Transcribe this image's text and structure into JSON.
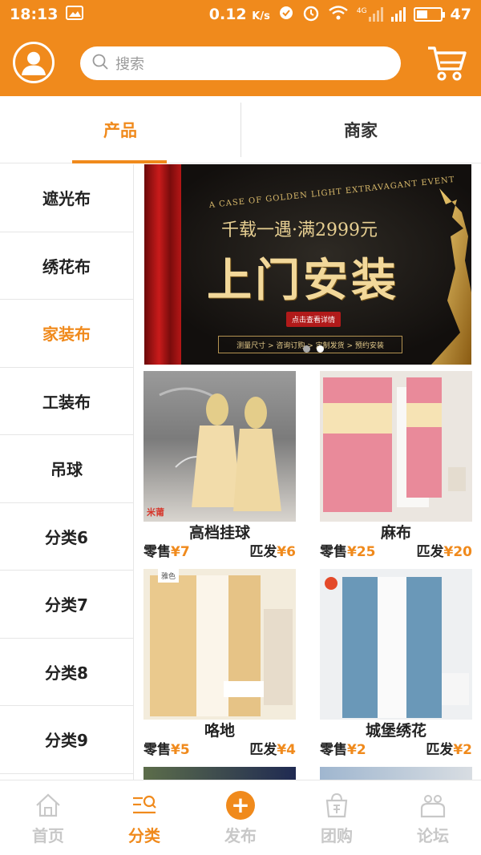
{
  "status_bar": {
    "time": "18:13",
    "speed": "0.12",
    "speed_unit": "K/s",
    "network": "4G",
    "battery": "47",
    "battery_level": 0.47
  },
  "header": {
    "search_placeholder": "搜索",
    "avatar_icon": "user-icon",
    "cart_icon": "cart-icon"
  },
  "tabs": [
    {
      "label": "产品",
      "active": true
    },
    {
      "label": "商家",
      "active": false
    }
  ],
  "sidebar": {
    "items": [
      {
        "label": "遮光布",
        "active": false
      },
      {
        "label": "绣花布",
        "active": false
      },
      {
        "label": "家装布",
        "active": true
      },
      {
        "label": "工装布",
        "active": false
      },
      {
        "label": "吊球",
        "active": false
      },
      {
        "label": "分类6",
        "active": false
      },
      {
        "label": "分类7",
        "active": false
      },
      {
        "label": "分类8",
        "active": false
      },
      {
        "label": "分类9",
        "active": false
      }
    ]
  },
  "banner": {
    "eng_text": "A CASE OF GOLDEN LIGHT EXTRAVAGANT EVENT",
    "subtitle": "千载一遇·满2999元",
    "headline": "上门安装",
    "button": "点击查看详情",
    "steps": "测量尺寸 > 咨询订购 > 定制发货 > 预约安装"
  },
  "products": [
    {
      "name": "高档挂球",
      "retail_label": "零售",
      "retail_price": "¥7",
      "wholesale_label": "匹发",
      "wholesale_price": "¥6",
      "watermark": "米莆"
    },
    {
      "name": "麻布",
      "retail_label": "零售",
      "retail_price": "¥25",
      "wholesale_label": "匹发",
      "wholesale_price": "¥20"
    },
    {
      "name": "咯地",
      "retail_label": "零售",
      "retail_price": "¥5",
      "wholesale_label": "匹发",
      "wholesale_price": "¥4",
      "tag": "雅色"
    },
    {
      "name": "城堡绣花",
      "retail_label": "零售",
      "retail_price": "¥2",
      "wholesale_label": "匹发",
      "wholesale_price": "¥2"
    }
  ],
  "bottom_nav": [
    {
      "label": "首页",
      "icon": "home-icon",
      "active": false
    },
    {
      "label": "分类",
      "icon": "category-search-icon",
      "active": true
    },
    {
      "label": "发布",
      "icon": "plus-icon",
      "active": false
    },
    {
      "label": "团购",
      "icon": "group-buy-bag-icon",
      "active": false
    },
    {
      "label": "论坛",
      "icon": "forum-people-icon",
      "active": false
    }
  ],
  "colors": {
    "accent": "#f08a1c",
    "inactive": "#c8c8c8",
    "text": "#222222"
  }
}
